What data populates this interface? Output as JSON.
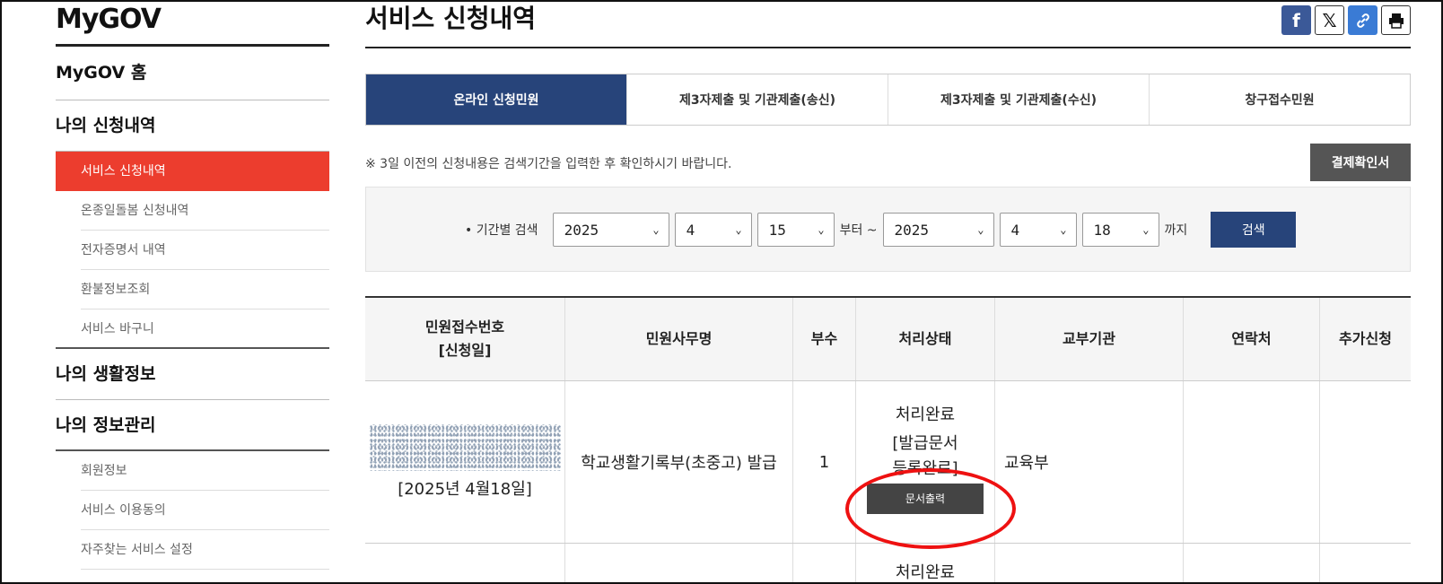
{
  "sidebar": {
    "logo": "MyGOV",
    "home": "MyGOV 홈",
    "section1": "나의 신청내역",
    "items1": [
      "서비스 신청내역",
      "온종일돌봄 신청내역",
      "전자증명서 내역",
      "환불정보조회",
      "서비스 바구니"
    ],
    "section2": "나의 생활정보",
    "section3": "나의 정보관리",
    "items3": [
      "회원정보",
      "서비스 이용동의",
      "자주찾는 서비스 설정"
    ]
  },
  "main": {
    "title": "서비스 신청내역",
    "share_icons": [
      "facebook-icon",
      "x-icon",
      "link-icon",
      "print-icon"
    ],
    "tabs": [
      "온라인 신청민원",
      "제3자제출 및 기관제출(송신)",
      "제3자제출 및 기관제출(수신)",
      "창구접수민원"
    ],
    "notice": "※ 3일 이전의 신청내용은 검색기간을 입력한 후 확인하시기 바랍니다.",
    "pay_button": "결제확인서",
    "search": {
      "label": "• 기간별 검색",
      "from_year": "2025",
      "from_month": "4",
      "from_day": "15",
      "from_suffix": "부터 ~",
      "to_year": "2025",
      "to_month": "4",
      "to_day": "18",
      "to_suffix": "까지",
      "button": "검색"
    },
    "table": {
      "headers": [
        "민원접수번호\n[신청일]",
        "민원사무명",
        "부수",
        "처리상태",
        "교부기관",
        "연락처",
        "추가신청"
      ],
      "header1_line1": "민원접수번호",
      "header1_line2": "[신청일]",
      "rows": [
        {
          "date": "[2025년 4월18일]",
          "name": "학교생활기록부(초중고) 발급",
          "count": "1",
          "status_line1": "처리완료",
          "status_line2": "[발급문서",
          "status_line3": "등록완료]",
          "print_button": "문서출력",
          "agency": "교육부",
          "contact": "",
          "extra": ""
        },
        {
          "status_line1": "처리완료"
        }
      ]
    }
  },
  "colors": {
    "active_tab": "#27447a",
    "active_side": "#ec3d2e",
    "highlight": "#e11111"
  }
}
